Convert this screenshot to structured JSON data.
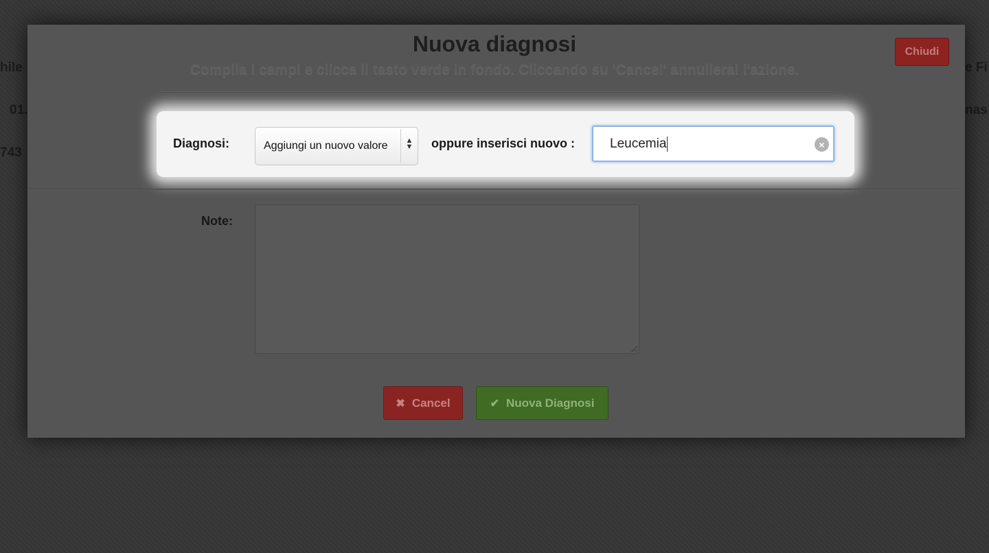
{
  "background": {
    "fragments": [
      "hile",
      "01.",
      "743",
      "e Fi",
      "nas"
    ]
  },
  "modal": {
    "title": "Nuova diagnosi",
    "subtitle": "Compila i campi e clicca il tasto verde in fondo. Cliccando su 'Cancel' annullerai l'azione.",
    "close_label": "Chiudi",
    "diagnosi_label": "Diagnosi:",
    "select": {
      "selected": "Aggiungi un nuovo valore",
      "arrow_icon": "select-arrows-icon"
    },
    "new_value_label": "oppure inserisci nuovo :",
    "new_value_input": {
      "value": "Leucemia",
      "clear_icon": "clear-icon"
    },
    "note_label": "Note:",
    "note_value": "",
    "cancel_label": "Cancel",
    "cancel_icon": "close-icon",
    "save_label": "Nuova Diagnosi",
    "save_icon": "check-icon"
  },
  "colors": {
    "close": "#8c2320",
    "cancel": "#8a2422",
    "save": "#3f6b25",
    "input_focus": "#8fb6e3"
  }
}
